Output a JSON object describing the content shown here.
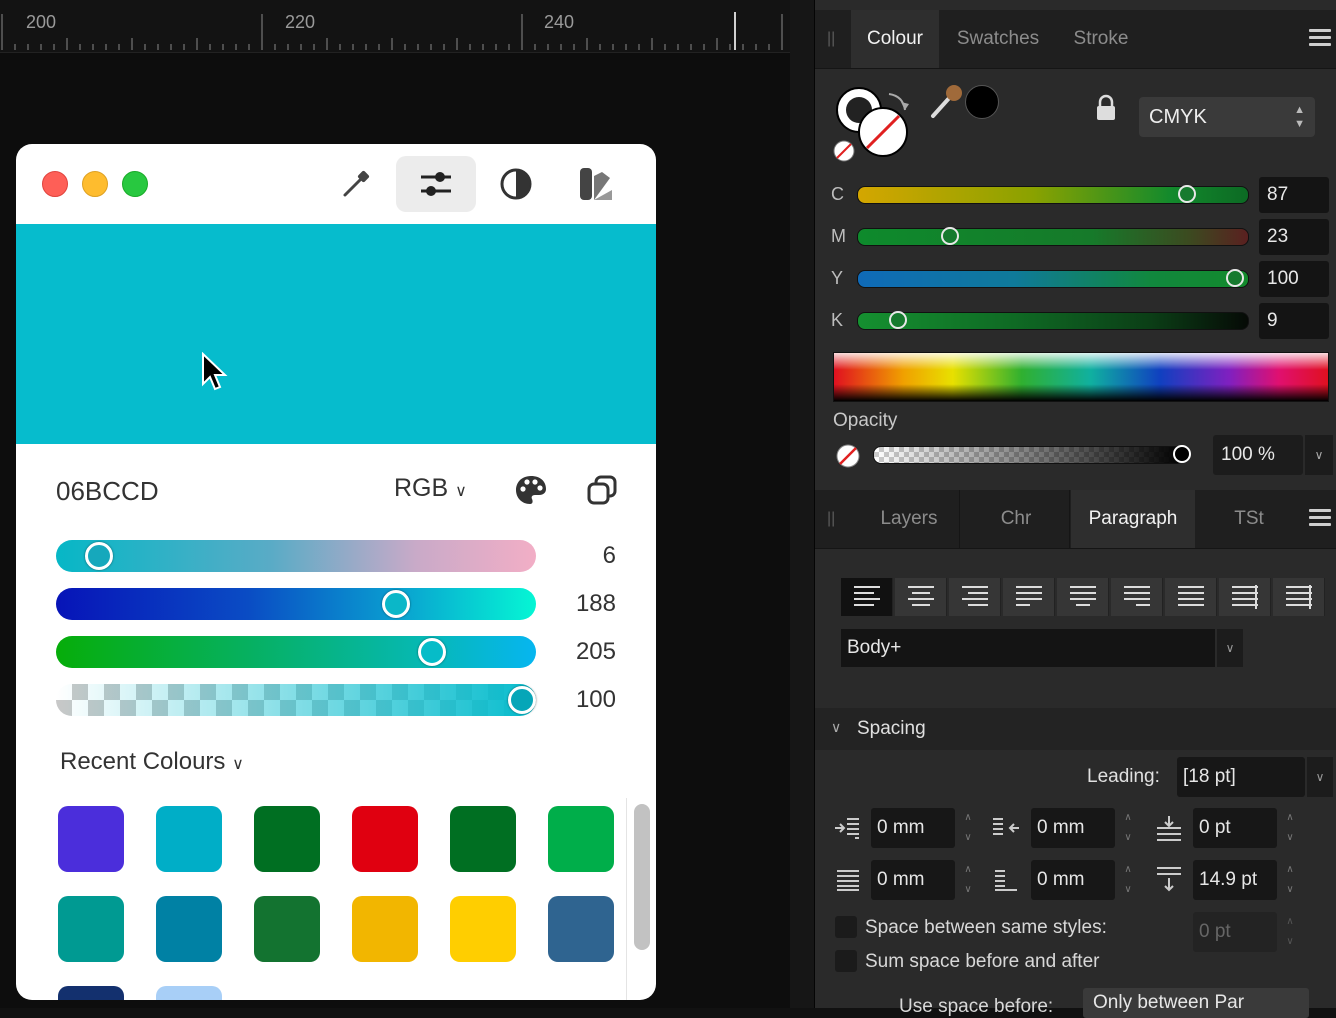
{
  "ruler": {
    "labels": [
      "200",
      "220",
      "240"
    ]
  },
  "colour_panel": {
    "tabs": [
      "Colour",
      "Swatches",
      "Stroke"
    ],
    "mode": "CMYK",
    "channels": [
      {
        "label": "C",
        "value": "87",
        "fraction": 0.87
      },
      {
        "label": "M",
        "value": "23",
        "fraction": 0.23
      },
      {
        "label": "Y",
        "value": "100",
        "fraction": 1.0
      },
      {
        "label": "K",
        "value": "9",
        "fraction": 0.09
      }
    ],
    "opacity_label": "Opacity",
    "opacity_value": "100 %",
    "opacity_fraction": 1.0
  },
  "paragraph_panel": {
    "tabs": [
      "Layers",
      "Chr",
      "Paragraph",
      "TSt"
    ],
    "style": "Body+",
    "spacing_label": "Spacing",
    "leading_label": "Leading:",
    "leading_value": "[18 pt]",
    "fields": {
      "left_indent": "0 mm",
      "right_indent": "0 mm",
      "space_before": "0 pt",
      "first_line": "0 mm",
      "last_line": "0 mm",
      "space_after": "14.9 pt",
      "same_styles_value": "0 pt"
    },
    "same_styles_label": "Space between same styles:",
    "sum_space_label": "Sum space before and after",
    "use_space_label": "Use space before:",
    "use_space_value": "Only between Par"
  },
  "picker": {
    "preview_color": "#06BCCD",
    "hex": "06BCCD",
    "model": "RGB",
    "channels": [
      {
        "value": "6",
        "fraction": 0.06
      },
      {
        "value": "188",
        "fraction": 0.72
      },
      {
        "value": "205",
        "fraction": 0.8
      },
      {
        "value": "100",
        "fraction": 1.0
      }
    ],
    "recent_label": "Recent Colours",
    "recent_colors": [
      "#4B2EDB",
      "#00AEC7",
      "#006F22",
      "#E00010",
      "#006F22",
      "#00AE4A",
      "#009A92",
      "#0081A4",
      "#137330",
      "#F2B600",
      "#FFCE00",
      "#2F6490",
      "#13306E",
      "#A8CFF7"
    ]
  }
}
